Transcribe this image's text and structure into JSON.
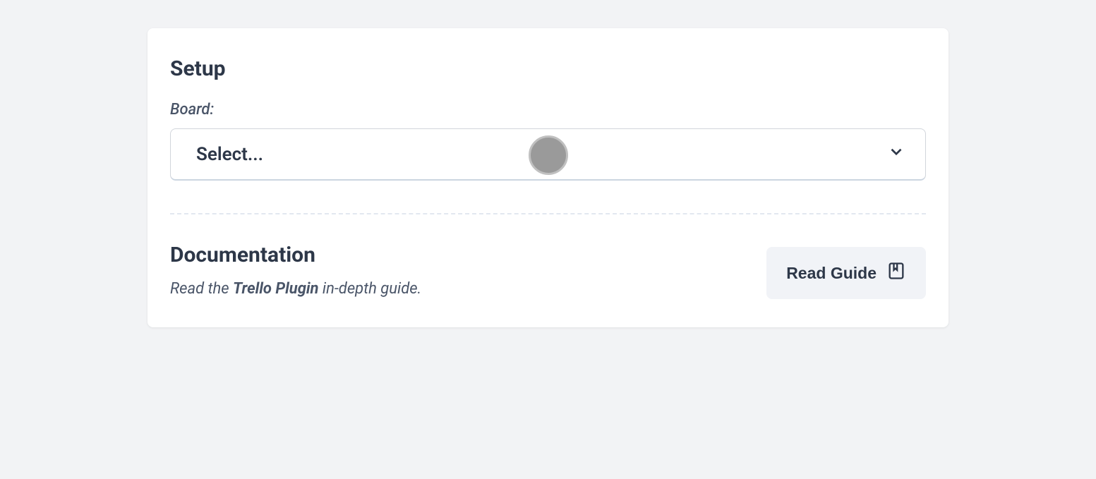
{
  "setup": {
    "title": "Setup",
    "board_label": "Board:",
    "select_placeholder": "Select..."
  },
  "documentation": {
    "title": "Documentation",
    "desc_prefix": "Read the ",
    "desc_strong": "Trello Plugin",
    "desc_suffix": " in-depth guide.",
    "button_label": "Read Guide"
  }
}
